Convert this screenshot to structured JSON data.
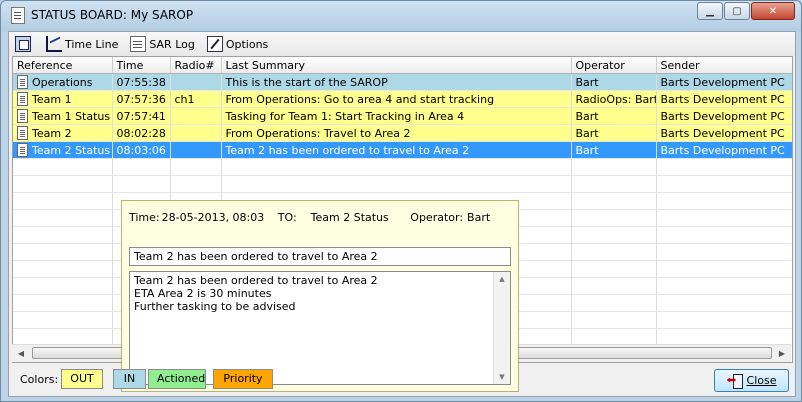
{
  "window": {
    "title": "STATUS BOARD: My SAROP"
  },
  "toolbar": {
    "items": [
      {
        "label": "",
        "icon": "tile-windows-icon"
      },
      {
        "label": "Time Line",
        "icon": "chart-icon"
      },
      {
        "label": "SAR Log",
        "icon": "document-icon"
      },
      {
        "label": "Options",
        "icon": "wrench-icon"
      }
    ]
  },
  "grid": {
    "columns": [
      "Reference",
      "Time",
      "Radio#",
      "Last Summary",
      "Operator",
      "Sender"
    ],
    "rows": [
      {
        "cells": [
          "Operations",
          "07:55:38",
          "",
          "This is the start of the SAROP",
          "Bart",
          "Barts Development PC"
        ],
        "bg": "#add8e6",
        "selected": false
      },
      {
        "cells": [
          "Team 1",
          "07:57:36",
          "ch1",
          "From Operations: Go to area 4 and start tracking",
          "RadioOps: Bart",
          "Barts Development PC"
        ],
        "bg": "#ffff8c",
        "selected": false
      },
      {
        "cells": [
          "Team 1 Status",
          "07:57:41",
          "",
          "Tasking for Team 1: Start Tracking in Area 4",
          "Bart",
          "Barts Development PC"
        ],
        "bg": "#ffff8c",
        "selected": false
      },
      {
        "cells": [
          "Team 2",
          "08:02:28",
          "",
          "From Operations: Travel to Area 2",
          "Bart",
          "Barts Development PC"
        ],
        "bg": "#ffff8c",
        "selected": false
      },
      {
        "cells": [
          "Team 2 Status",
          "08:03:06",
          "",
          "Team 2 has been ordered to travel to Area 2",
          "Bart",
          "Barts Development PC"
        ],
        "bg": "#3399ff",
        "selected": true
      }
    ]
  },
  "popup": {
    "time_label": "Time:",
    "time_value": "28-05-2013,  08:03",
    "to_label": "TO:",
    "to_value": "Team 2 Status",
    "operator_label": "Operator:",
    "operator_value": "Bart",
    "summary": "Team 2 has been ordered to travel to Area 2",
    "body_lines": [
      "Team 2 has been ordered to travel to Area 2",
      "ETA Area 2 is 30 minutes",
      "Further tasking to be advised"
    ]
  },
  "legend": {
    "label": "Colors:",
    "swatches": [
      {
        "label": "OUT",
        "color": "#ffff8c"
      },
      {
        "label": "IN",
        "color": "#add8e6"
      },
      {
        "label": "Actioned",
        "color": "#90ee90"
      },
      {
        "label": "Priority",
        "color": "#ffa500"
      }
    ]
  },
  "close_button": {
    "label": "Close"
  }
}
